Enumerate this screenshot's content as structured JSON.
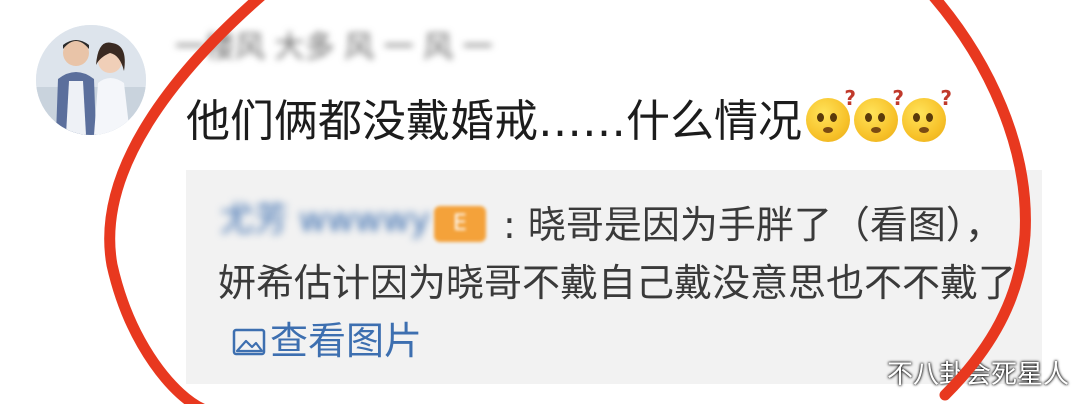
{
  "user": {
    "name_blurred": "一楼风 大多 风 一 风 一",
    "avatar": "couple-photo-avatar"
  },
  "comment": {
    "text": "他们俩都没戴婚戒……什么情况",
    "emojis": [
      "thinking-face-emoji",
      "thinking-face-emoji",
      "thinking-face-emoji"
    ]
  },
  "reply": {
    "user_blurred": "尤芳 wwwwy",
    "badge_blurred": "E",
    "text": ": 晓哥是因为手胖了（看图），妍希估计因为晓哥不戴自己戴没意思也不不戴了",
    "view_image_label": "查看图片",
    "view_image_icon": "image-icon"
  },
  "watermark": "不八卦会死星人",
  "colors": {
    "link": "#3d6fb0",
    "annotation": "#e8381f",
    "reply_bg": "#f2f2f2"
  }
}
